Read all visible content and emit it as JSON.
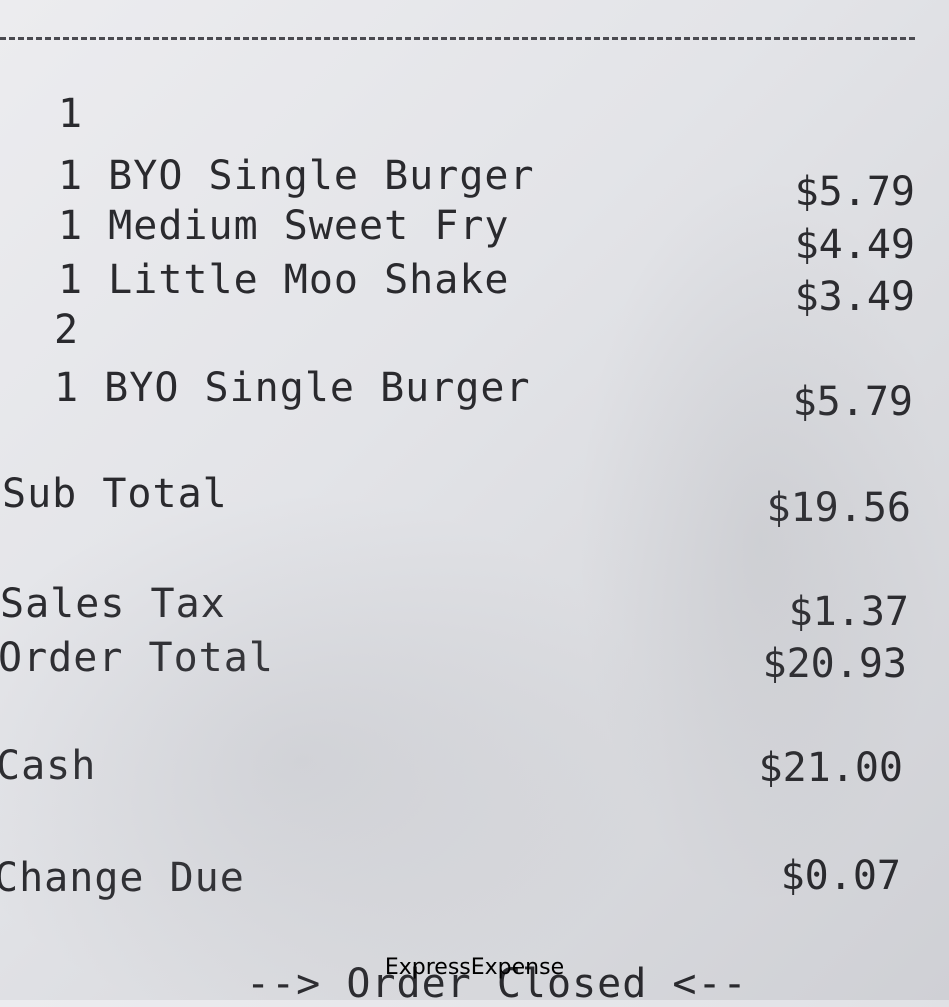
{
  "receipt": {
    "groups": [
      {
        "number": "1",
        "items": [
          {
            "text": "1 BYO Single Burger",
            "price": "$5.79"
          },
          {
            "text": "1 Medium Sweet Fry",
            "price": "$4.49"
          },
          {
            "text": "1 Little Moo Shake",
            "price": "$3.49"
          }
        ]
      },
      {
        "number": "2",
        "items": [
          {
            "text": "1 BYO Single Burger",
            "price": "$5.79"
          }
        ]
      }
    ],
    "sub_total": {
      "label": "Sub Total",
      "value": "$19.56"
    },
    "sales_tax": {
      "label": "Sales Tax",
      "value": "$1.37"
    },
    "order_total": {
      "label": "Order Total",
      "value": "$20.93"
    },
    "cash": {
      "label": "Cash",
      "value": "$21.00"
    },
    "change_due": {
      "label": "Change Due",
      "value": "$0.07"
    },
    "footer": "--> Order Closed <--"
  },
  "watermark": "ExpressExpense"
}
